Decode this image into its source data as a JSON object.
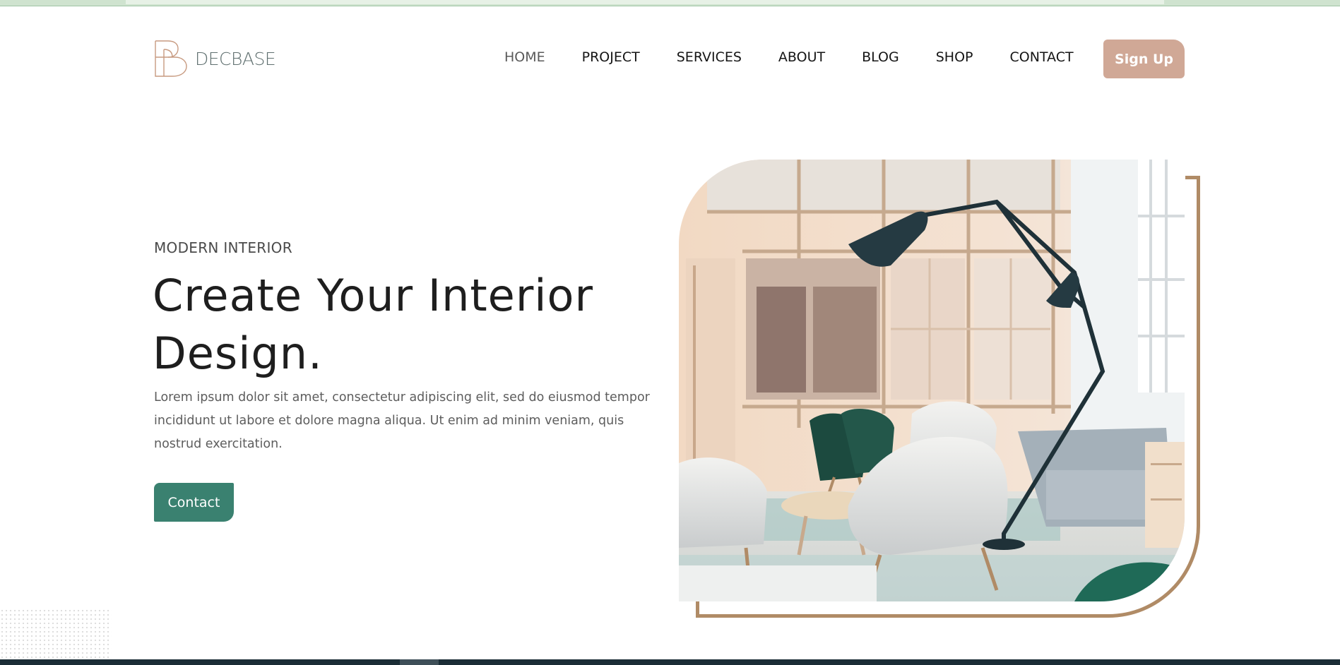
{
  "brand": {
    "name": "DECBASE",
    "logo_icon": "b-monogram-icon"
  },
  "nav": {
    "items": [
      {
        "label": "HOME",
        "active": true
      },
      {
        "label": "PROJECT"
      },
      {
        "label": "SERVICES"
      },
      {
        "label": "ABOUT"
      },
      {
        "label": "BLOG"
      },
      {
        "label": "SHOP"
      },
      {
        "label": "CONTACT"
      }
    ],
    "signup_label": "Sign Up"
  },
  "hero": {
    "subtitle": "MODERN INTERIOR",
    "title": "Create Your Interior Design.",
    "description": "Lorem ipsum dolor sit amet, consectetur adipiscing elit, sed do eiusmod tempor incididunt ut labore et dolore magna aliqua. Ut enim ad minim veniam, quis nostrud exercitation.",
    "cta_label": "Contact",
    "image": "interior-photo"
  },
  "colors": {
    "accent_brown": "#b08b66",
    "signup_bg": "#d0a896",
    "cta_green": "#3a8170",
    "logo_text": "#5f6f6f"
  }
}
